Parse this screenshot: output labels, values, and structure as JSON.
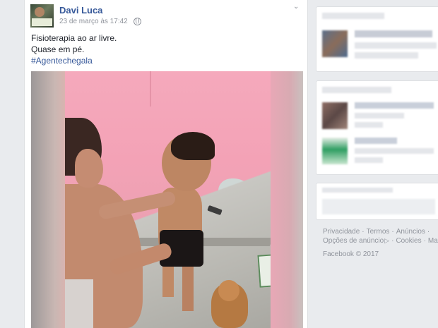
{
  "post": {
    "author": "Davi Luca",
    "timestamp": "23 de março às 17:42",
    "privacy_icon": "globe-icon",
    "menu_icon": "chevron-down-icon",
    "text_lines": [
      "Fisioterapia ao ar livre.",
      "Quase em pé."
    ],
    "hashtag": "#Agentechegala"
  },
  "sidebar": {
    "footer": {
      "row1": [
        "Privacidade",
        "Termos",
        "Anúncios"
      ],
      "row2": [
        "Opções de anúncio",
        "Cookies",
        "Mais"
      ],
      "separator": "·",
      "copyright": "Facebook © 2017"
    }
  },
  "colors": {
    "link": "#365899",
    "meta": "#90949c",
    "background": "#e9ebee"
  }
}
